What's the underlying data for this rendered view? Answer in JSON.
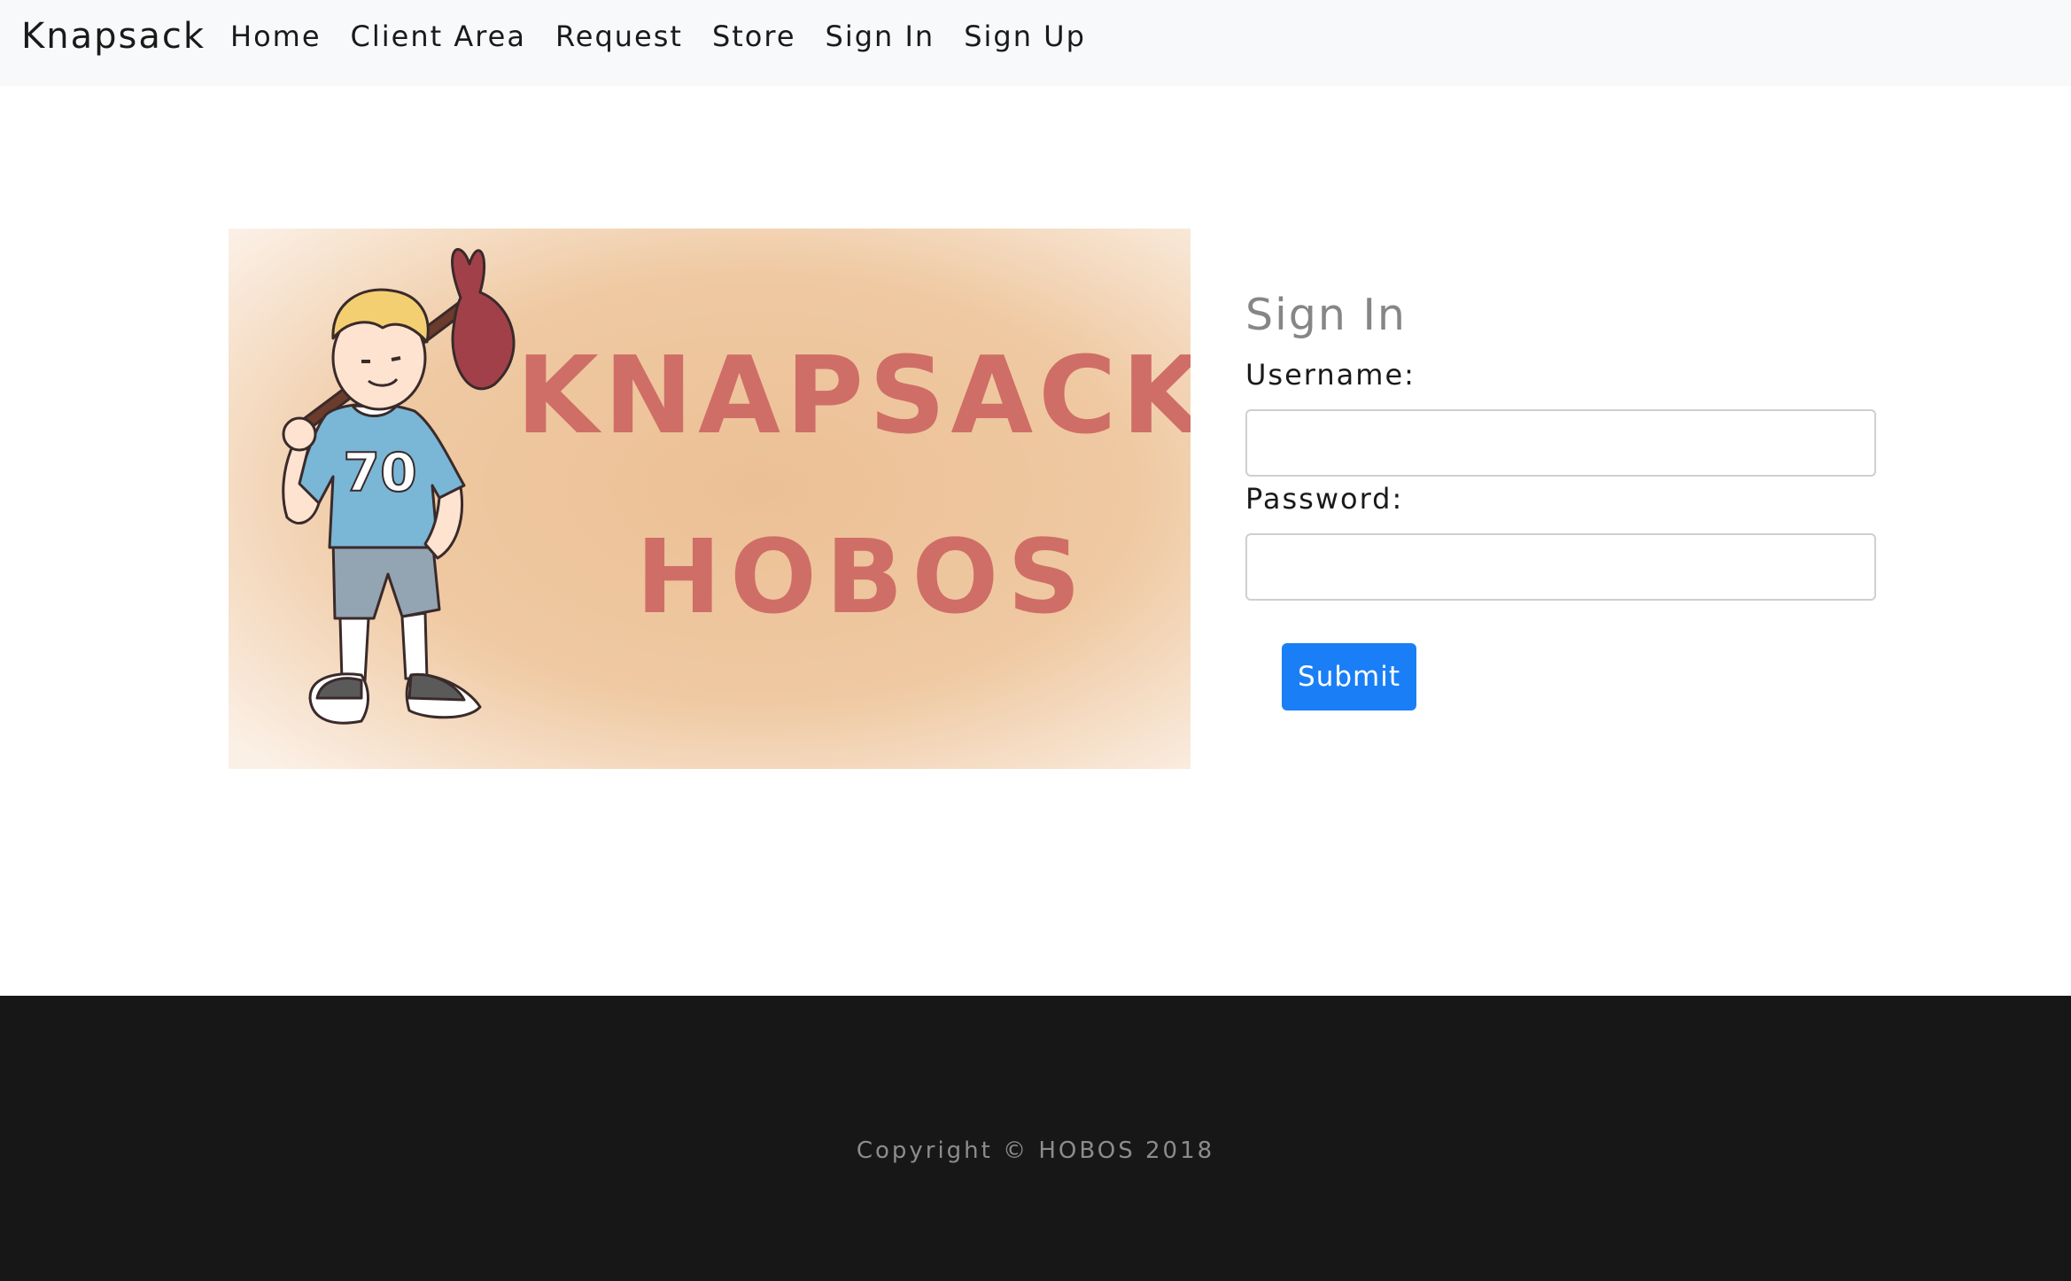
{
  "navbar": {
    "brand": "Knapsack",
    "links": [
      {
        "label": "Home"
      },
      {
        "label": "Client Area"
      },
      {
        "label": "Request"
      },
      {
        "label": "Store"
      },
      {
        "label": "Sign In"
      },
      {
        "label": "Sign Up"
      }
    ]
  },
  "hero": {
    "line1": "KNAPSACK",
    "line2": "HOBOS",
    "shirt_number": "70"
  },
  "signin": {
    "title": "Sign In",
    "username_label": "Username:",
    "username_value": "",
    "password_label": "Password:",
    "password_value": "",
    "submit_label": "Submit"
  },
  "footer": {
    "copyright": "Copyright © HOBOS 2018"
  },
  "colors": {
    "navbar_bg": "#f8f9fa",
    "primary_button": "#1a7ff6",
    "footer_bg": "#171717",
    "hero_text": "#cf6e66",
    "hero_bg": "#ecc096"
  }
}
